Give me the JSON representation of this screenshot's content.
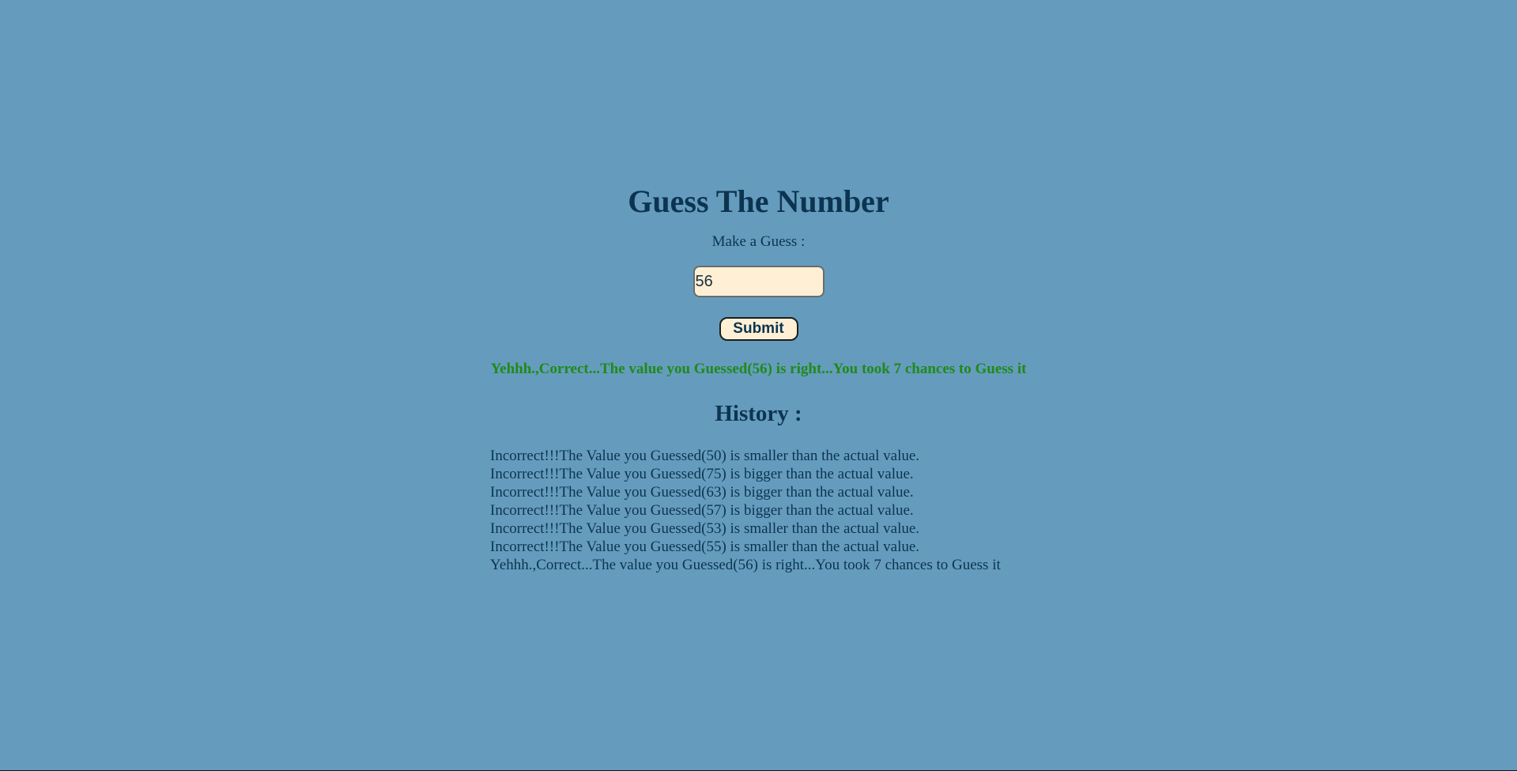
{
  "game": {
    "title": "Guess The Number",
    "prompt": "Make a Guess :",
    "input_value": "56",
    "submit_label": "Submit",
    "result_message": "Yehhh.,Correct...The value you Guessed(56) is right...You took 7 chances to Guess it"
  },
  "history": {
    "title": "History :",
    "items": [
      "Incorrect!!!The Value you Guessed(50) is smaller than the actual value.",
      "Incorrect!!!The Value you Guessed(75) is bigger than the actual value.",
      "Incorrect!!!The Value you Guessed(63) is bigger than the actual value.",
      "Incorrect!!!The Value you Guessed(57) is bigger than the actual value.",
      "Incorrect!!!The Value you Guessed(53) is smaller than the actual value.",
      "Incorrect!!!The Value you Guessed(55) is smaller than the actual value.",
      "Yehhh.,Correct...The value you Guessed(56) is right...You took 7 chances to Guess it"
    ]
  },
  "colors": {
    "background": "#659cbd",
    "text": "#0c3450",
    "success": "#1f8a19",
    "input_background": "#fff0d5"
  }
}
